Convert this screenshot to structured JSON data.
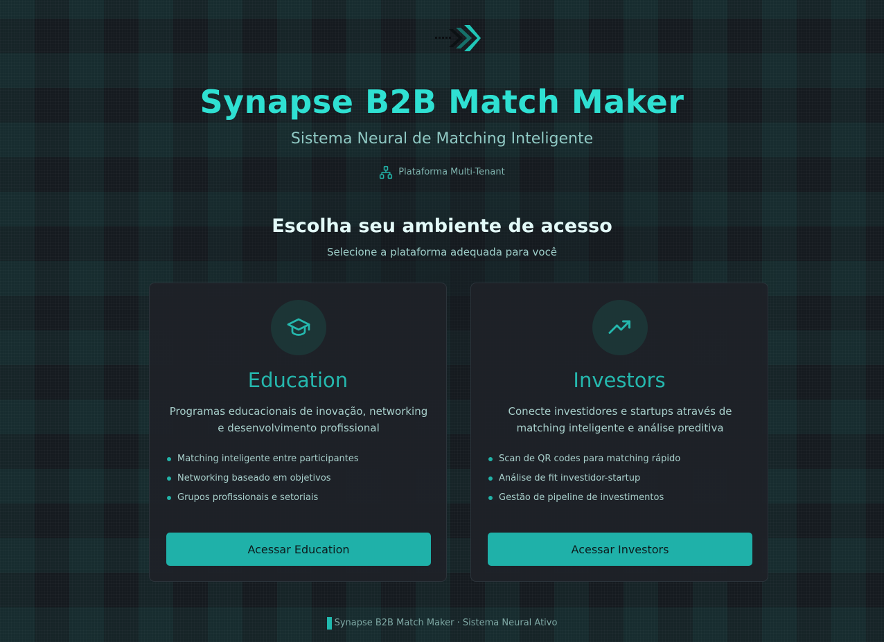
{
  "app": {
    "title": "Synapse B2B Match Maker",
    "subtitle": "Sistema Neural de Matching Inteligente",
    "tenant_badge": "Plataforma Multi-Tenant",
    "logo_icon": "arrow-forward-logo-icon"
  },
  "section": {
    "title": "Escolha seu ambiente de acesso",
    "subtitle": "Selecione a plataforma adequada para você"
  },
  "cards": [
    {
      "icon": "graduation-cap-icon",
      "title": "Education",
      "description": "Programas educacionais de inovação, networking e desenvolvimento profissional",
      "features": [
        "Matching inteligente entre participantes",
        "Networking baseado em objetivos",
        "Grupos profissionais e setoriais"
      ],
      "button_label": "Acessar Education"
    },
    {
      "icon": "trending-up-icon",
      "title": "Investors",
      "description": "Conecte investidores e startups através de matching inteligente e análise preditiva",
      "features": [
        "Scan de QR codes para matching rápido",
        "Análise de fit investidor-startup",
        "Gestão de pipeline de investimentos"
      ],
      "button_label": "Acessar Investors"
    }
  ],
  "footer": {
    "text": "Synapse B2B Match Maker · Sistema Neural Ativo"
  },
  "colors": {
    "accent": "#1fb1a9",
    "title": "#2fe0d2",
    "background": "#151a1f",
    "card": "#1e2128"
  }
}
